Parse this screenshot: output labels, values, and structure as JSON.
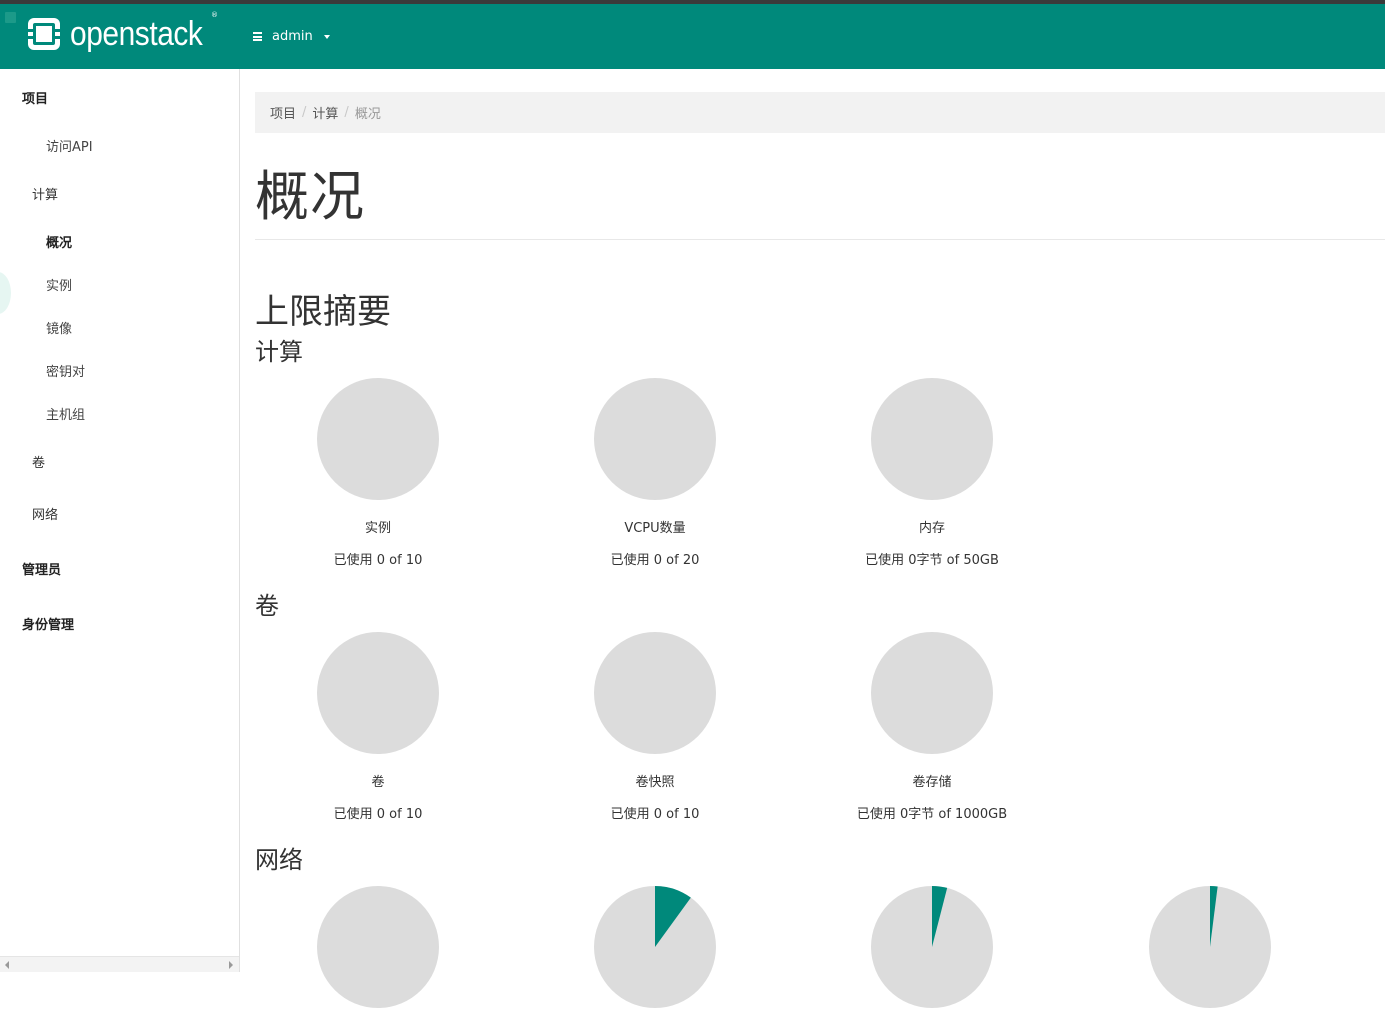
{
  "header": {
    "brand": "openstack",
    "brand_mark": "®",
    "project_selector": "admin",
    "colors": {
      "brand_bar": "#00897b",
      "accent": "#00897b",
      "pie_empty": "#dcdcdc"
    }
  },
  "sidebar": {
    "project": "项目",
    "api_access": "访问API",
    "compute": "计算",
    "compute_items": [
      "概况",
      "实例",
      "镜像",
      "密钥对",
      "主机组"
    ],
    "volumes": "卷",
    "network": "网络",
    "admin": "管理员",
    "identity": "身份管理"
  },
  "breadcrumb": [
    "项目",
    "计算",
    "概况"
  ],
  "page_title": "概况",
  "limit_summary": {
    "title": "上限摘要",
    "sections": [
      {
        "title": "计算",
        "charts": [
          {
            "label": "实例",
            "usage": "已使用 0 of 10",
            "fraction": 0
          },
          {
            "label": "VCPU数量",
            "usage": "已使用 0 of 20",
            "fraction": 0
          },
          {
            "label": "内存",
            "usage": "已使用 0字节 of 50GB",
            "fraction": 0
          }
        ]
      },
      {
        "title": "卷",
        "charts": [
          {
            "label": "卷",
            "usage": "已使用 0 of 10",
            "fraction": 0
          },
          {
            "label": "卷快照",
            "usage": "已使用 0 of 10",
            "fraction": 0
          },
          {
            "label": "卷存储",
            "usage": "已使用 0字节 of 1000GB",
            "fraction": 0
          }
        ]
      },
      {
        "title": "网络",
        "charts": [
          {
            "fraction": 0
          },
          {
            "fraction": 0.1
          },
          {
            "fraction": 0.04
          },
          {
            "fraction": 0.02
          }
        ]
      }
    ]
  }
}
